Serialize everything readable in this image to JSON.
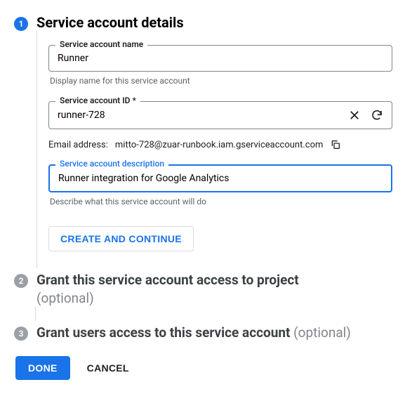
{
  "step1": {
    "badge": "1",
    "title": "Service account details",
    "nameField": {
      "label": "Service account name",
      "value": "Runner",
      "helper": "Display name for this service account"
    },
    "idField": {
      "label": "Service account ID *",
      "value": "runner-728"
    },
    "emailLabel": "Email address:",
    "emailValue": "mitto-728@zuar-runbook.iam.gserviceaccount.com",
    "descField": {
      "label": "Service account description",
      "value": "Runner integration for Google Analytics",
      "helper": "Describe what this service account will do"
    },
    "createBtn": "CREATE AND CONTINUE"
  },
  "step2": {
    "badge": "2",
    "title": "Grant this service account access to project",
    "optional": "(optional)"
  },
  "step3": {
    "badge": "3",
    "title": "Grant users access to this service account",
    "optional": "(optional)"
  },
  "footer": {
    "done": "DONE",
    "cancel": "CANCEL"
  }
}
